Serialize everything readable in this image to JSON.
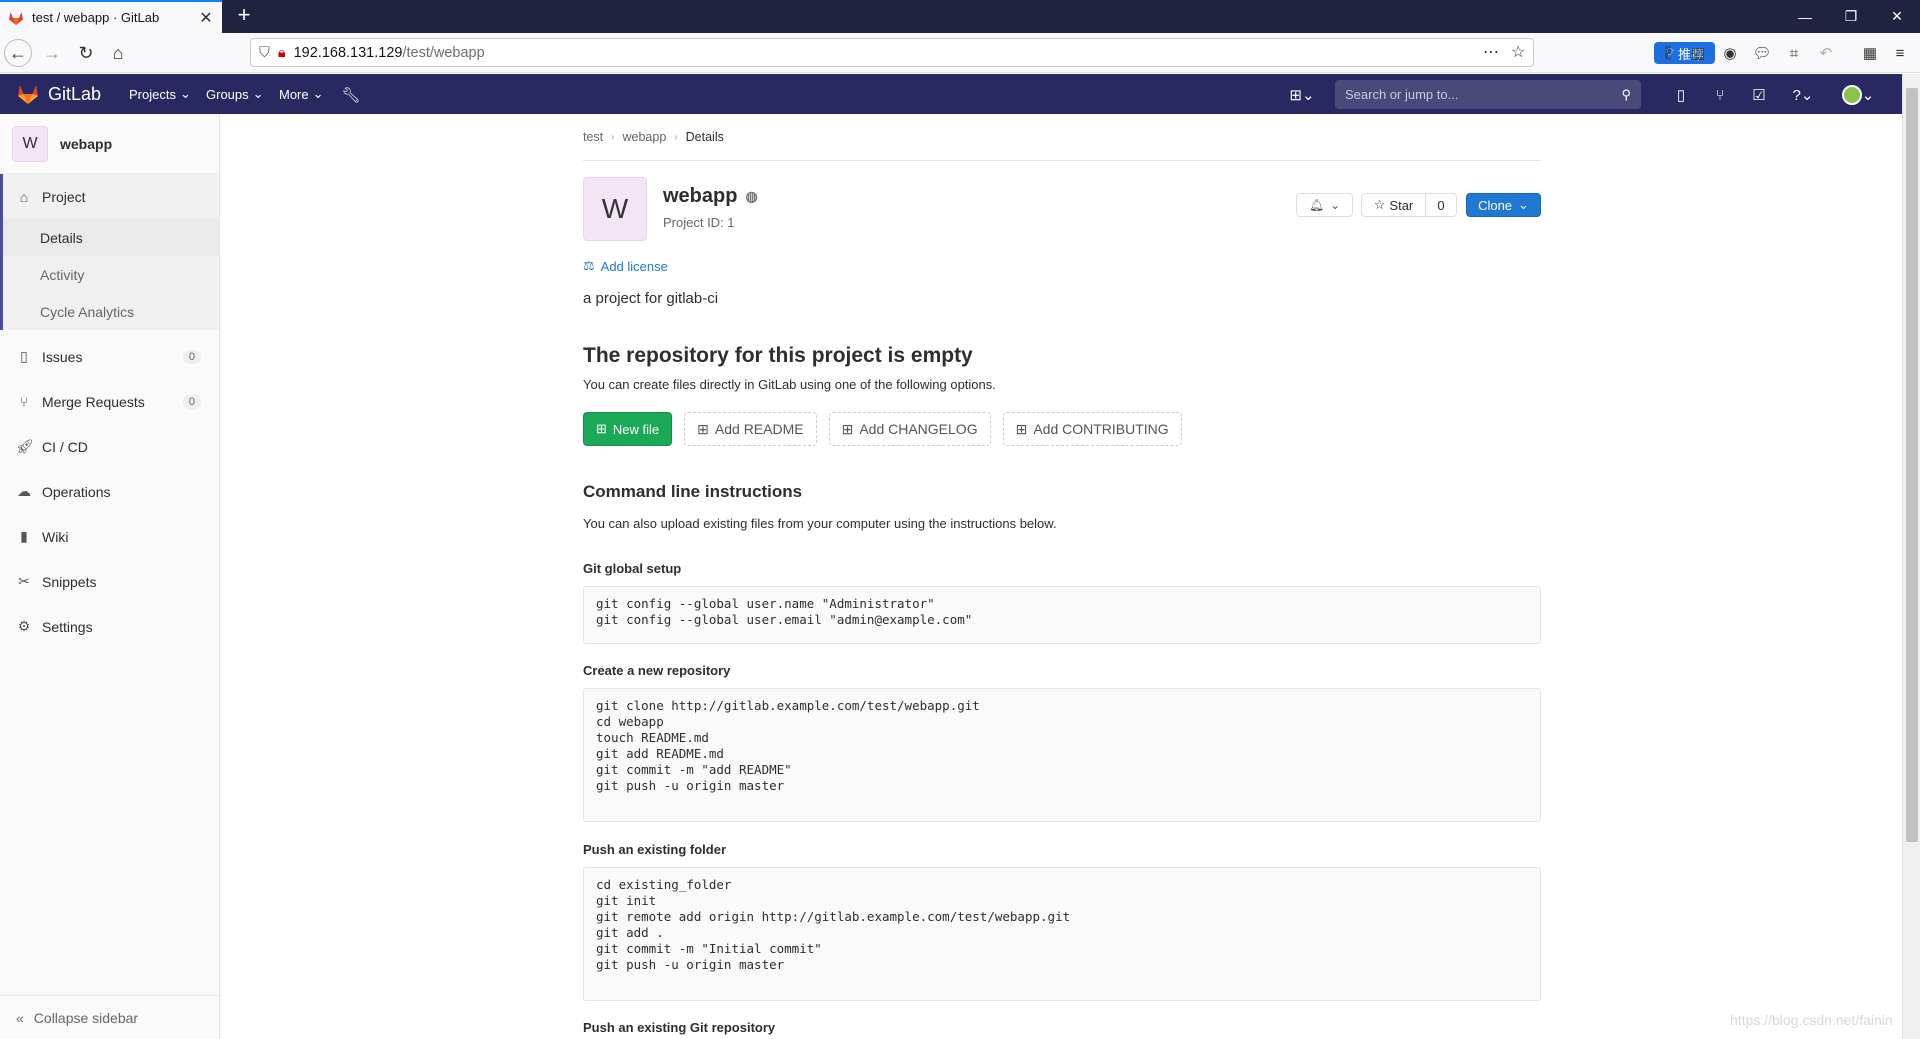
{
  "browser": {
    "tab_title": "test / webapp · GitLab",
    "url_host": "192.168.131.129",
    "url_path": "/test/webapp",
    "recommend_label": "推荐"
  },
  "header": {
    "brand": "GitLab",
    "menus": [
      "Projects",
      "Groups",
      "More"
    ],
    "search_placeholder": "Search or jump to..."
  },
  "sidebar": {
    "avatar_letter": "W",
    "project_name": "webapp",
    "project_label": "Project",
    "sub_items": [
      "Details",
      "Activity",
      "Cycle Analytics"
    ],
    "items": [
      {
        "label": "Issues",
        "count": "0"
      },
      {
        "label": "Merge Requests",
        "count": "0"
      },
      {
        "label": "CI / CD"
      },
      {
        "label": "Operations"
      },
      {
        "label": "Wiki"
      },
      {
        "label": "Snippets"
      },
      {
        "label": "Settings"
      }
    ],
    "collapse_label": "Collapse sidebar"
  },
  "breadcrumb": [
    "test",
    "webapp",
    "Details"
  ],
  "project": {
    "avatar_letter": "W",
    "name": "webapp",
    "id_label": "Project ID: 1",
    "star_label": "Star",
    "star_count": "0",
    "clone_label": "Clone",
    "add_license": "Add license",
    "description": "a project for gitlab-ci"
  },
  "empty": {
    "heading": "The repository for this project is empty",
    "text": "You can create files directly in GitLab using one of the following options.",
    "new_file": "New file",
    "add_readme": "Add README",
    "add_changelog": "Add CHANGELOG",
    "add_contributing": "Add CONTRIBUTING"
  },
  "cli": {
    "heading": "Command line instructions",
    "text": "You can also upload existing files from your computer using the instructions below.",
    "sections": [
      {
        "title": "Git global setup",
        "code": "git config --global user.name \"Administrator\"\ngit config --global user.email \"admin@example.com\""
      },
      {
        "title": "Create a new repository",
        "code": "git clone http://gitlab.example.com/test/webapp.git\ncd webapp\ntouch README.md\ngit add README.md\ngit commit -m \"add README\"\ngit push -u origin master"
      },
      {
        "title": "Push an existing folder",
        "code": "cd existing_folder\ngit init\ngit remote add origin http://gitlab.example.com/test/webapp.git\ngit add .\ngit commit -m \"Initial commit\"\ngit push -u origin master"
      },
      {
        "title": "Push an existing Git repository",
        "code": ""
      }
    ]
  },
  "watermark": "https://blog.csdn.net/fainin",
  "colors": {
    "header_bg": "#292961",
    "accent": "#1f78d1",
    "success": "#1aaa55"
  }
}
